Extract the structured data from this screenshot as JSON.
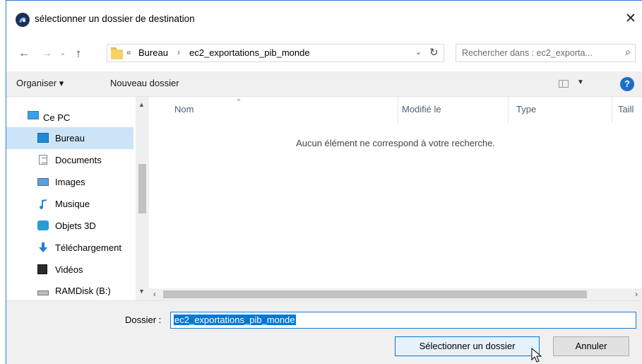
{
  "window": {
    "title": "sélectionner un dossier de destination",
    "close_glyph": "✕"
  },
  "nav": {
    "back": "←",
    "forward": "→",
    "recent": "⌄",
    "up": "↑",
    "breadcrumb_overflow": "«",
    "breadcrumbs": [
      "Bureau",
      "ec2_exportations_pib_monde"
    ],
    "crumb_separator": "›",
    "dropdown": "⌄",
    "refresh": "↻"
  },
  "search": {
    "placeholder": "Rechercher dans : ec2_exporta...",
    "icon": "search-icon"
  },
  "toolbar": {
    "organise_label": "Organiser ▾",
    "new_folder_label": "Nouveau dossier",
    "view_dropdown": "▼",
    "help_label": "?"
  },
  "sidebar": {
    "items": [
      {
        "label": "Ce PC",
        "icon": "pc-icon"
      },
      {
        "label": "Bureau",
        "icon": "desktop-icon",
        "selected": true
      },
      {
        "label": "Documents",
        "icon": "documents-icon"
      },
      {
        "label": "Images",
        "icon": "images-icon"
      },
      {
        "label": "Musique",
        "icon": "music-icon"
      },
      {
        "label": "Objets 3D",
        "icon": "objects-3d-icon"
      },
      {
        "label": "Téléchargement",
        "icon": "download-icon"
      },
      {
        "label": "Vidéos",
        "icon": "videos-icon"
      },
      {
        "label": "RAMDisk (B:)",
        "icon": "drive-icon"
      }
    ]
  },
  "filelist": {
    "columns": [
      "Nom",
      "Modifié le",
      "Type",
      "Taill"
    ],
    "sort_indicator": "^",
    "empty_message": "Aucun élément ne correspond à votre recherche."
  },
  "bottom": {
    "folder_label": "Dossier :",
    "folder_value": "ec2_exportations_pib_monde",
    "select_button": "Sélectionner un dossier",
    "cancel_button": "Annuler"
  },
  "colors": {
    "accent": "#0078d7",
    "selection_bg": "#cce4f7",
    "toolbar_bg": "#f0f0f0"
  }
}
